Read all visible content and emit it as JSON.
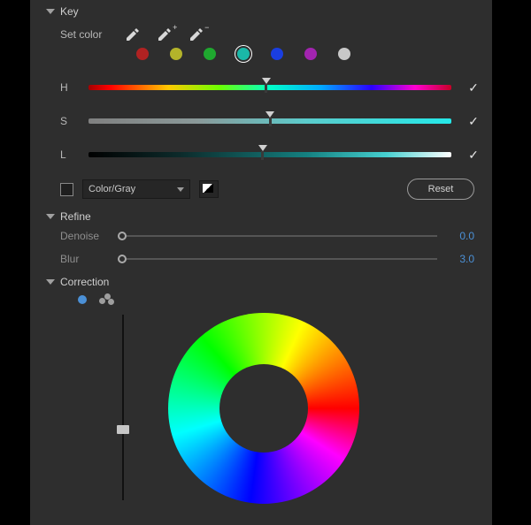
{
  "sections": {
    "key": "Key",
    "refine": "Refine",
    "correction": "Correction"
  },
  "set_color_label": "Set color",
  "swatches": [
    "#b02222",
    "#b3b32a",
    "#1fa82f",
    "#1ab8a8",
    "#1a3ee0",
    "#a224b0",
    "#c8c8c8"
  ],
  "active_swatch_index": 3,
  "hsl": {
    "h": {
      "label": "H",
      "pos_pct": 49,
      "checked": true
    },
    "s": {
      "label": "S",
      "pos_pct": 50,
      "checked": true
    },
    "l": {
      "label": "L",
      "pos_pct": 48,
      "checked": true
    }
  },
  "color_gray": {
    "checkbox_checked": false,
    "label": "Color/Gray"
  },
  "reset_label": "Reset",
  "refine": {
    "denoise": {
      "label": "Denoise",
      "value": "0.0",
      "pos_pct": 0
    },
    "blur": {
      "label": "Blur",
      "value": "3.0",
      "pos_pct": 0
    }
  },
  "wheel": {
    "vpos_pct": 62
  }
}
